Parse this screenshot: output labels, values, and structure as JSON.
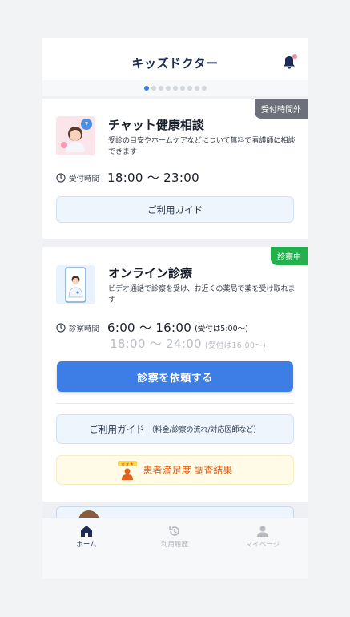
{
  "header": {
    "title": "キッズドクター"
  },
  "carousel": {
    "total": 9,
    "active": 0
  },
  "chat_card": {
    "badge": "受付時間外",
    "title": "チャット健康相談",
    "description": "受診の目安やホームケアなどについて無料で看護師に相談できます",
    "hours_label": "受付時間",
    "hours": "18:00 〜 23:00",
    "guide_button": "ご利用ガイド"
  },
  "online_card": {
    "badge": "診察中",
    "title": "オンライン診療",
    "description": "ビデオ通話で診察を受け、お近くの薬局で薬を受け取れます",
    "hours_label": "診察時間",
    "hours_primary": "6:00 〜 16:00",
    "hours_primary_note": "(受付は5:00〜)",
    "hours_secondary": "18:00 〜 24:00",
    "hours_secondary_note": "(受付は16:00〜)",
    "request_button": "診察を依頼する",
    "guide_button": "ご利用ガイド",
    "guide_button_note": "（料金/診察の流れ/対応医師など）",
    "survey_button": "患者満足度 調査結果",
    "survey_stars": "★★★"
  },
  "tabbar": {
    "items": [
      {
        "label": "ホーム",
        "icon": "home-icon"
      },
      {
        "label": "利用履歴",
        "icon": "history-icon"
      },
      {
        "label": "マイページ",
        "icon": "person-icon"
      }
    ]
  },
  "colors": {
    "accent": "#3c7de6",
    "brand_text": "#1c2a55",
    "badge_closed": "#6d7078",
    "badge_open": "#22b14c",
    "survey_text": "#e0601d"
  }
}
